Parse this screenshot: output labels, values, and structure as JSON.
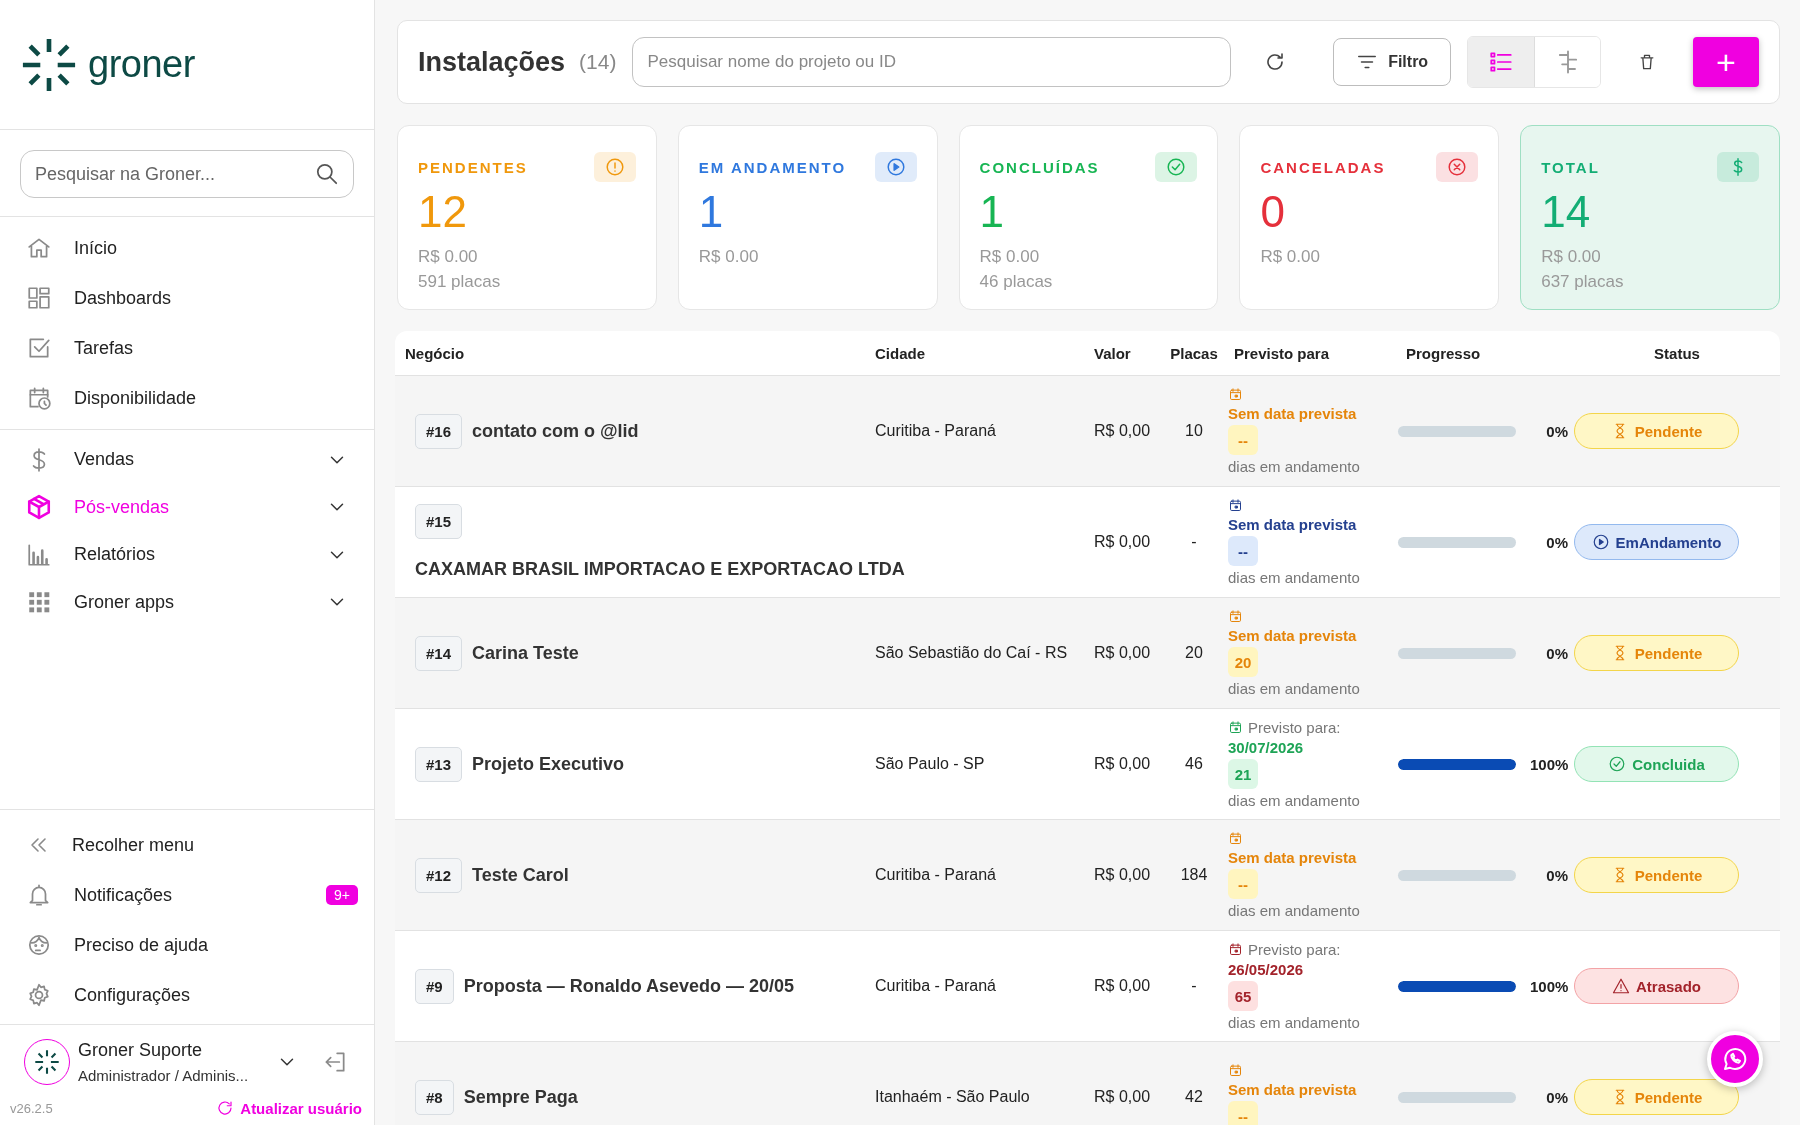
{
  "sidebar": {
    "brand": "groner",
    "search": {
      "placeholder": "Pesquisar na Groner..."
    },
    "nav_main": [
      {
        "label": "Início",
        "selected": false
      },
      {
        "label": "Dashboards",
        "selected": false
      },
      {
        "label": "Tarefas",
        "selected": false
      },
      {
        "label": "Disponibilidade",
        "selected": false
      }
    ],
    "nav_modules": [
      {
        "label": "Vendas",
        "selected": false
      },
      {
        "label": "Pós-vendas",
        "selected": true
      },
      {
        "label": "Relatórios",
        "selected": false
      },
      {
        "label": "Groner apps",
        "selected": false
      }
    ],
    "footer_items": [
      {
        "label": "Recolher menu"
      },
      {
        "label": "Notificações",
        "badge": "9+"
      },
      {
        "label": "Preciso de ajuda"
      },
      {
        "label": "Configurações"
      }
    ],
    "user": {
      "name": "Groner Suporte",
      "role": "Administrador / Adminis..."
    },
    "version": "v26.2.5",
    "refresh_link": "Atualizar usuário"
  },
  "header": {
    "title": "Instalações",
    "count": "(14)",
    "search": {
      "placeholder": "Pesquisar nome do projeto ou ID"
    },
    "filter_button": "Filtro",
    "views": [
      {
        "selected": true
      },
      {
        "selected": false
      }
    ],
    "add_button": "+"
  },
  "cards": [
    {
      "color": "#f0980c",
      "highlighted": false,
      "label": "PENDENTES",
      "count": "12",
      "amount": "R$ 0.00",
      "plates": "591 placas"
    },
    {
      "color": "#2f78de",
      "highlighted": false,
      "label": "EM ANDAMENTO",
      "count": "1",
      "amount": "R$ 0.00"
    },
    {
      "color": "#17b553",
      "highlighted": false,
      "label": "CONCLUÍDAS",
      "count": "1",
      "amount": "R$ 0.00",
      "plates": "46 placas"
    },
    {
      "color": "#e5303b",
      "highlighted": false,
      "label": "CANCELADAS",
      "count": "0",
      "amount": "R$ 0.00"
    },
    {
      "color": "#13ad74",
      "highlighted": true,
      "label": "TOTAL",
      "count": "14",
      "amount": "R$ 0.00",
      "plates": "637 placas"
    }
  ],
  "table": {
    "columns": [
      "Negócio",
      "Cidade",
      "Valor",
      "Placas",
      "Previsto para",
      "Progresso",
      "Status"
    ],
    "rows": [
      {
        "id": "#16",
        "title": "contato com o @lid",
        "title_below": false,
        "city": "Curitiba - Paraná",
        "value": "R$ 0,00",
        "plates": "10",
        "schedule": "Sem data prevista",
        "days": "--",
        "days_label": "dias em andamento",
        "level": 0,
        "percent": "0%",
        "status": {
          "kind": "pendente",
          "label": "Pendente"
        }
      },
      {
        "id": "#15",
        "title": "CAXAMAR BRASIL IMPORTACAO E EXPORTACAO LTDA",
        "title_below": true,
        "value": "R$ 0,00",
        "plates": "-",
        "schedule": "Sem data prevista",
        "days": "--",
        "days_label": "dias em andamento",
        "level": 0,
        "percent": "0%",
        "status": {
          "kind": "andamento",
          "label": "EmAndamento"
        }
      },
      {
        "id": "#14",
        "title": "Carina Teste",
        "title_below": false,
        "city": "São Sebastião do Caí - RS",
        "value": "R$ 0,00",
        "plates": "20",
        "schedule": "Sem data prevista",
        "days": "20",
        "days_label": "dias em andamento",
        "level": 0,
        "percent": "0%",
        "status": {
          "kind": "pendente",
          "label": "Pendente"
        }
      },
      {
        "id": "#13",
        "title": "Projeto Executivo",
        "title_below": false,
        "city": "São Paulo - SP",
        "value": "R$ 0,00",
        "plates": "46",
        "schedule": "Previsto para:",
        "date": "30/07/2026",
        "days": "21",
        "days_label": "dias em andamento",
        "level": 1,
        "percent": "100%",
        "status": {
          "kind": "concluida",
          "label": "Concluida"
        }
      },
      {
        "id": "#12",
        "title": "Teste Carol",
        "title_below": false,
        "city": "Curitiba - Paraná",
        "value": "R$ 0,00",
        "plates": "184",
        "schedule": "Sem data prevista",
        "days": "--",
        "days_label": "dias em andamento",
        "level": 0,
        "percent": "0%",
        "status": {
          "kind": "pendente",
          "label": "Pendente"
        }
      },
      {
        "id": "#9",
        "title": "Proposta — Ronaldo Asevedo — 20/05",
        "title_below": false,
        "city": "Curitiba - Paraná",
        "value": "R$ 0,00",
        "plates": "-",
        "schedule": "Previsto para:",
        "date": "26/05/2026",
        "days": "65",
        "days_label": "dias em andamento",
        "level": 1,
        "percent": "100%",
        "status": {
          "kind": "atrasado",
          "label": "Atrasado"
        }
      },
      {
        "id": "#8",
        "title": "Sempre Paga",
        "title_below": false,
        "city": "Itanhaém - São Paulo",
        "value": "R$ 0,00",
        "plates": "42",
        "schedule": "Sem data prevista",
        "days": "--",
        "level": 0,
        "percent": "0%",
        "status": {
          "kind": "pendente",
          "label": "Pendente"
        }
      }
    ]
  }
}
